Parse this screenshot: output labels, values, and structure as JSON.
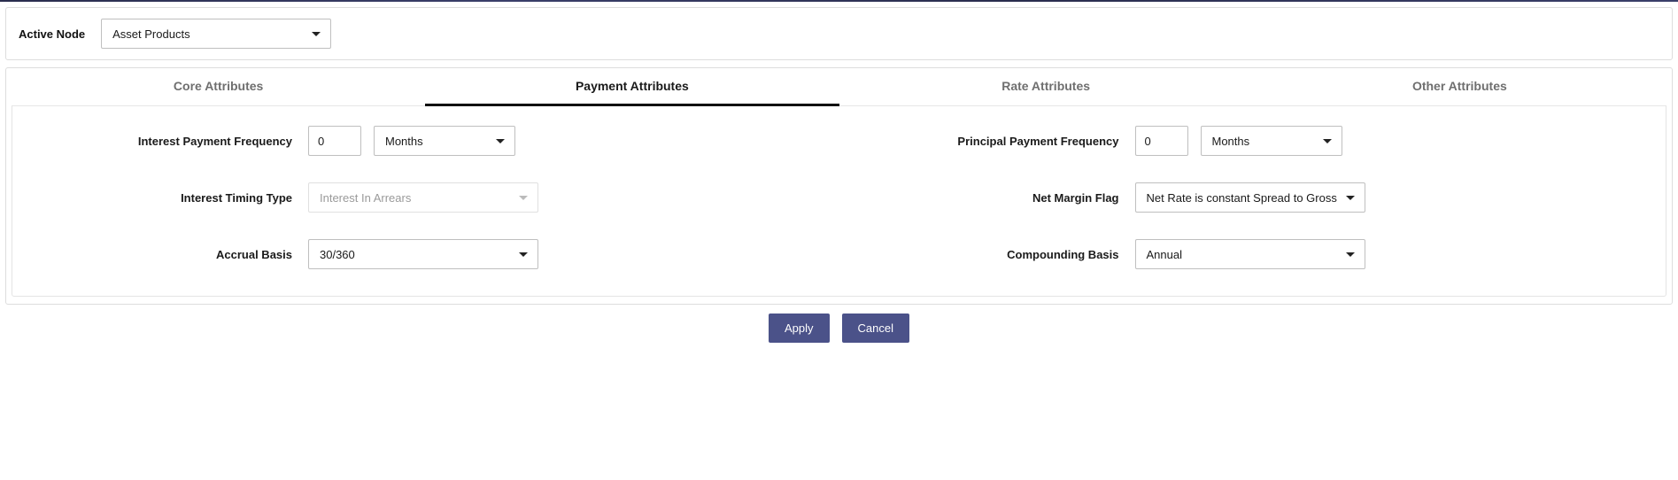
{
  "header": {
    "active_node_label": "Active Node",
    "active_node_value": "Asset Products"
  },
  "tabs": {
    "core": "Core Attributes",
    "payment": "Payment Attributes",
    "rate": "Rate Attributes",
    "other": "Other Attributes"
  },
  "form": {
    "interest_payment_frequency": {
      "label": "Interest Payment Frequency",
      "value": "0",
      "unit": "Months"
    },
    "principal_payment_frequency": {
      "label": "Principal Payment Frequency",
      "value": "0",
      "unit": "Months"
    },
    "interest_timing_type": {
      "label": "Interest Timing Type",
      "value": "Interest In Arrears"
    },
    "net_margin_flag": {
      "label": "Net Margin Flag",
      "value": "Net Rate is constant Spread to Gross"
    },
    "accrual_basis": {
      "label": "Accrual Basis",
      "value": "30/360"
    },
    "compounding_basis": {
      "label": "Compounding Basis",
      "value": "Annual"
    }
  },
  "buttons": {
    "apply": "Apply",
    "cancel": "Cancel"
  }
}
